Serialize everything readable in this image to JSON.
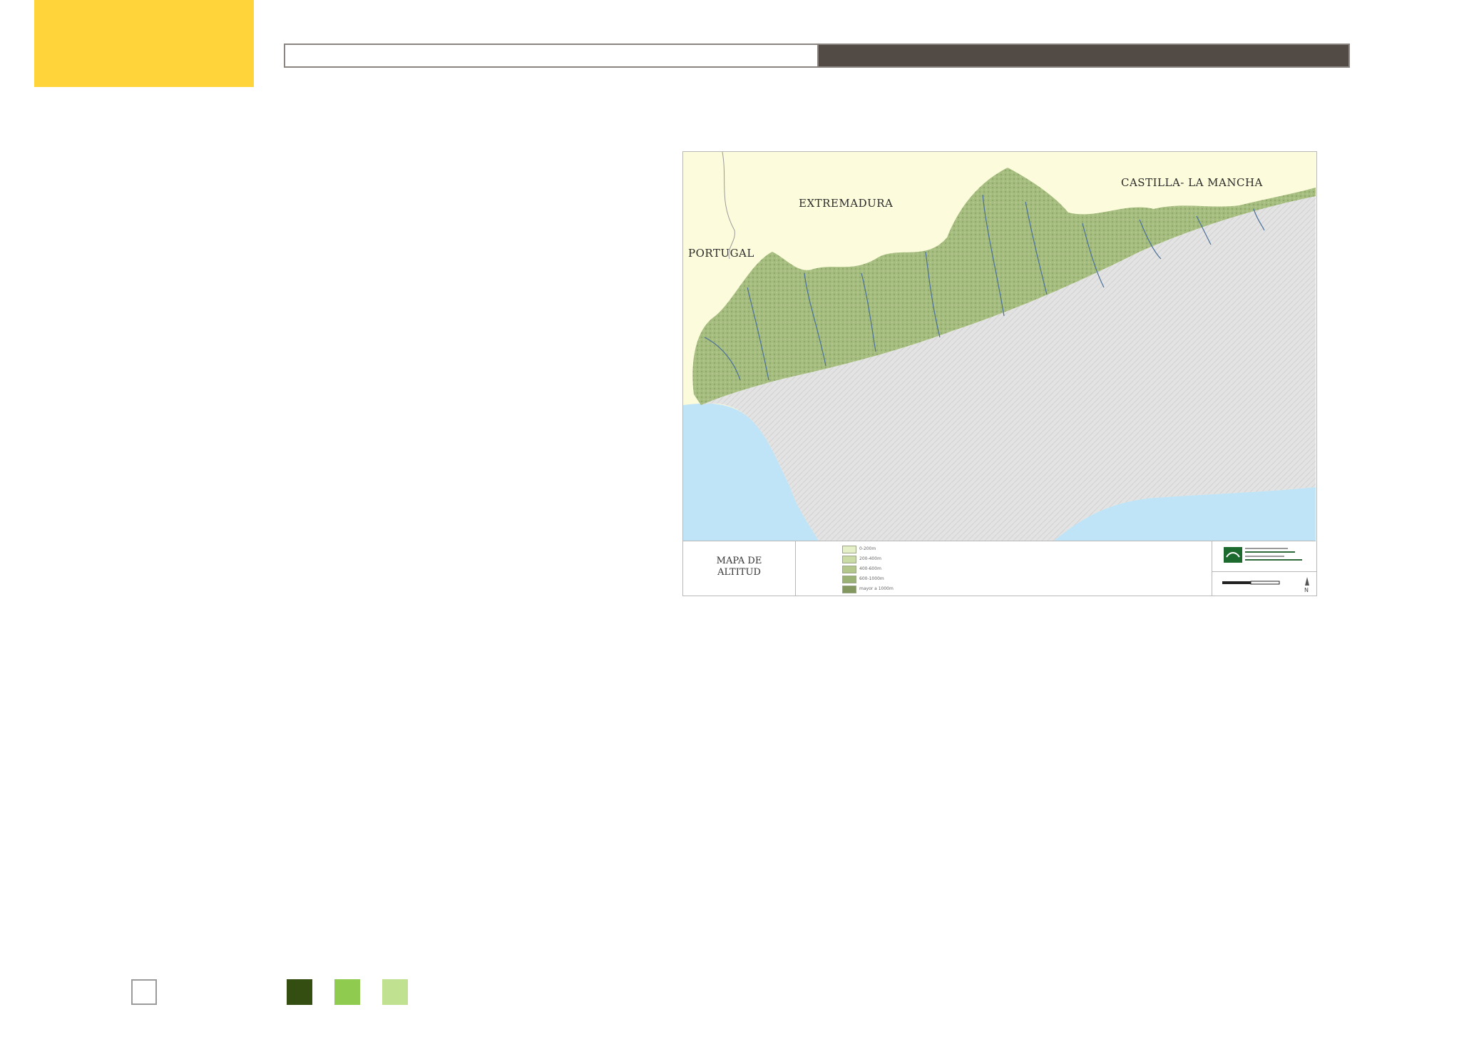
{
  "map": {
    "labels": {
      "extremadura": "EXTREMADURA",
      "castilla": "CASTILLA- LA MANCHA",
      "portugal": "PORTUGAL"
    },
    "legend_title": "MAPA DE ALTITUD",
    "legend_items": [
      {
        "label": "0-200m",
        "color": "#e6f0c8"
      },
      {
        "label": "200-400m",
        "color": "#cbdba6"
      },
      {
        "label": "400-600m",
        "color": "#b3c78d"
      },
      {
        "label": "600-1000m",
        "color": "#9bb276"
      },
      {
        "label": "mayor a 1000m",
        "color": "#83985f"
      }
    ],
    "colors": {
      "sea": "#bfe3f7",
      "outside_region": "#fcfbdb",
      "sierra_morena": "#a9bf85",
      "lowlands": "#e3e3e3",
      "rivers": "#4a6f9a"
    },
    "logo_icon": "junta-de-andalucia-logo-icon",
    "north_icon": "north-arrow-icon"
  },
  "color_chips": [
    {
      "name": "white-chip",
      "color": "#ffffff"
    },
    {
      "name": "dark-green-chip",
      "color": "#344e12"
    },
    {
      "name": "green-chip",
      "color": "#8ecb4e"
    },
    {
      "name": "light-green-chip",
      "color": "#c0e18f"
    }
  ],
  "header": {
    "tab_color": "#ffd33a",
    "bar_dark_color": "#524a45"
  }
}
